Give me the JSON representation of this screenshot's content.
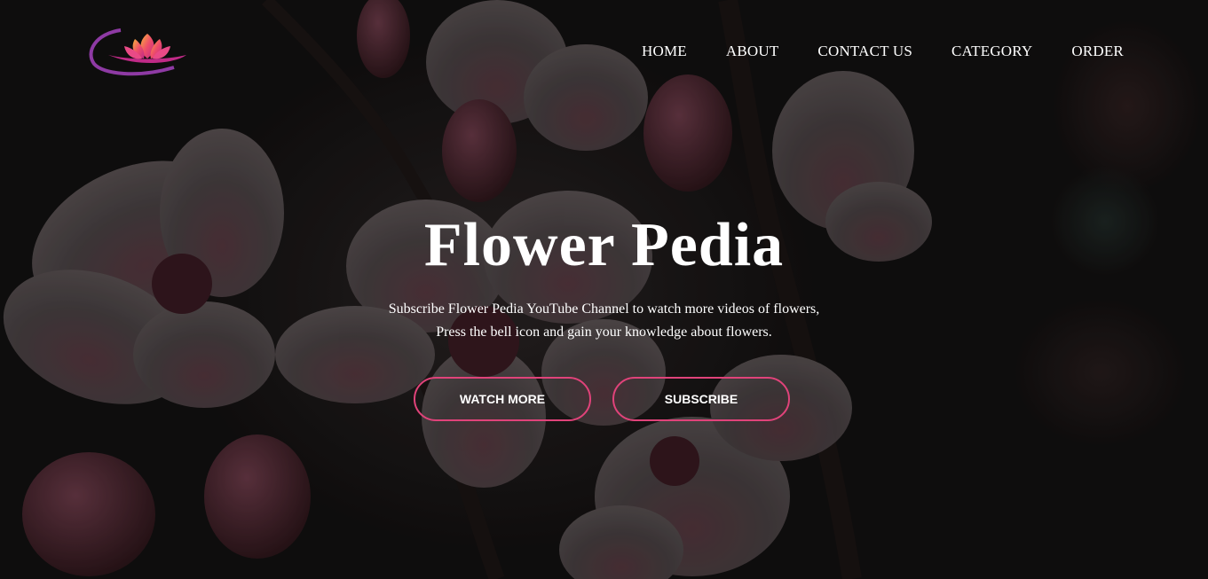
{
  "brand": {
    "logo_icon": "lotus-logo-icon",
    "accent_color": "#e0437a"
  },
  "nav": {
    "items": [
      {
        "label": "HOME"
      },
      {
        "label": "ABOUT"
      },
      {
        "label": "CONTACT US"
      },
      {
        "label": "CATEGORY"
      },
      {
        "label": "ORDER"
      }
    ]
  },
  "hero": {
    "title": "Flower Pedia",
    "line1": "Subscribe Flower Pedia YouTube Channel to watch more videos of flowers,",
    "line2": "Press the bell icon and gain your knowledge about flowers.",
    "primary_button": "WATCH MORE",
    "secondary_button": "SUBSCRIBE"
  }
}
